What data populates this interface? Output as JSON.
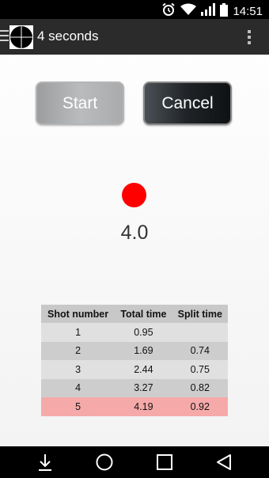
{
  "status_bar": {
    "time": "14:51"
  },
  "action_bar": {
    "title": "4 seconds"
  },
  "buttons": {
    "start_label": "Start",
    "cancel_label": "Cancel"
  },
  "indicator": {
    "color": "#ff0000",
    "value": "4.0"
  },
  "table": {
    "headers": [
      "Shot number",
      "Total time",
      "Split time"
    ],
    "rows": [
      [
        "1",
        "0.95",
        ""
      ],
      [
        "2",
        "1.69",
        "0.74"
      ],
      [
        "3",
        "2.44",
        "0.75"
      ],
      [
        "4",
        "3.27",
        "0.82"
      ],
      [
        "5",
        "4.19",
        "0.92"
      ]
    ],
    "highlight_color": "#f5a9a9"
  },
  "nav_bar": {
    "icons": [
      "download-icon",
      "home-icon",
      "recents-icon",
      "back-icon"
    ]
  }
}
